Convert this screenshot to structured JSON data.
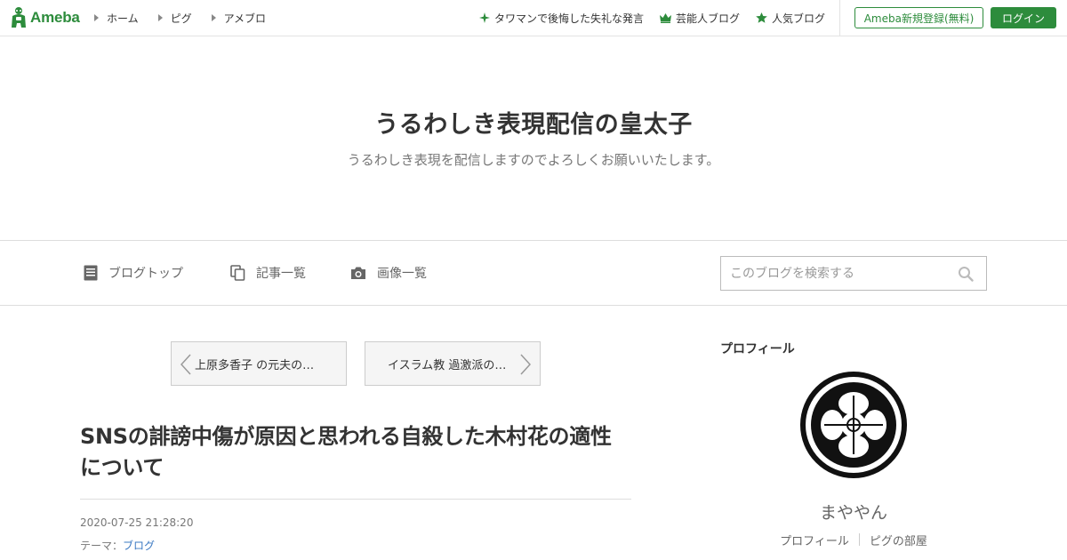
{
  "header": {
    "logo_text": "Ameba",
    "nav_left": [
      {
        "label": "ホーム"
      },
      {
        "label": "ピグ"
      },
      {
        "label": "アメブロ"
      }
    ],
    "nav_right": [
      {
        "label": "タワマンで後悔した失礼な発言",
        "icon": "sparkle-icon"
      },
      {
        "label": "芸能人ブログ",
        "icon": "crown-icon"
      },
      {
        "label": "人気ブログ",
        "icon": "star-icon"
      }
    ],
    "register_label": "Ameba新規登録(無料)",
    "login_label": "ログイン",
    "brand_color": "#2d8c3c"
  },
  "blog": {
    "title": "うるわしき表現配信の皇太子",
    "description": "うるわしき表現を配信しますのでよろしくお願いいたします。"
  },
  "blog_nav": {
    "items": [
      {
        "label": "ブログトップ",
        "icon": "document-icon"
      },
      {
        "label": "記事一覧",
        "icon": "copy-icon"
      },
      {
        "label": "画像一覧",
        "icon": "camera-icon"
      }
    ],
    "search_placeholder": "このブログを検索する"
  },
  "pager": {
    "prev_label": "上原多香子 の元夫の…",
    "next_label": "イスラム教 過激派の…"
  },
  "article": {
    "title": "SNSの誹謗中傷が原因と思われる自殺した木村花の適性について",
    "date": "2020-07-25 21:28:20",
    "theme_prefix": "テーマ：",
    "theme_link": "ブログ"
  },
  "profile": {
    "heading": "プロフィール",
    "name": "まややん",
    "links": [
      {
        "label": "プロフィール"
      },
      {
        "label": "ピグの部屋"
      }
    ]
  }
}
